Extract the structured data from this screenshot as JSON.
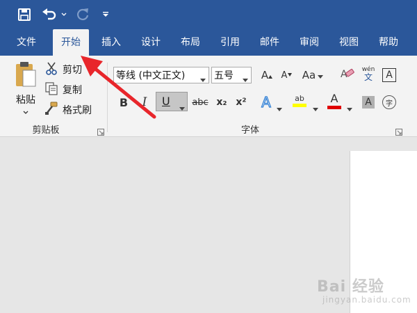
{
  "quick_access": {
    "icons": [
      "save-icon",
      "undo-icon",
      "redo-icon",
      "customize-dropdown-icon"
    ]
  },
  "tabs": [
    {
      "label": "文件"
    },
    {
      "label": "开始",
      "active": true
    },
    {
      "label": "插入"
    },
    {
      "label": "设计"
    },
    {
      "label": "布局"
    },
    {
      "label": "引用"
    },
    {
      "label": "邮件"
    },
    {
      "label": "审阅"
    },
    {
      "label": "视图"
    },
    {
      "label": "帮助"
    }
  ],
  "clipboard": {
    "paste_label": "粘贴",
    "cut_label": "剪切",
    "copy_label": "复制",
    "format_painter_label": "格式刷",
    "group_label": "剪贴板"
  },
  "font": {
    "font_name": "等线 (中文正文)",
    "font_size": "五号",
    "group_label": "字体",
    "grow_glyph": "A",
    "shrink_glyph": "A",
    "change_case_glyph": "Aa",
    "phonetic_top": "wén",
    "phonetic_bottom": "文",
    "border_glyph": "A",
    "bold_glyph": "B",
    "italic_glyph": "I",
    "underline_glyph": "U",
    "strike_glyph": "abc",
    "subscript_glyph": "x₂",
    "superscript_glyph": "x²",
    "text_effects_glyph": "A",
    "highlight_glyph": "ab",
    "font_color_glyph": "A",
    "shading_glyph": "A",
    "enclose_glyph": "字"
  },
  "colors": {
    "brand": "#2b579a",
    "highlight": "#ffff00",
    "font_color": "#e00000",
    "annotation_arrow": "#e8262b"
  },
  "watermark": {
    "main": "Bai 经验",
    "sub": "jingyan.baidu.com"
  }
}
